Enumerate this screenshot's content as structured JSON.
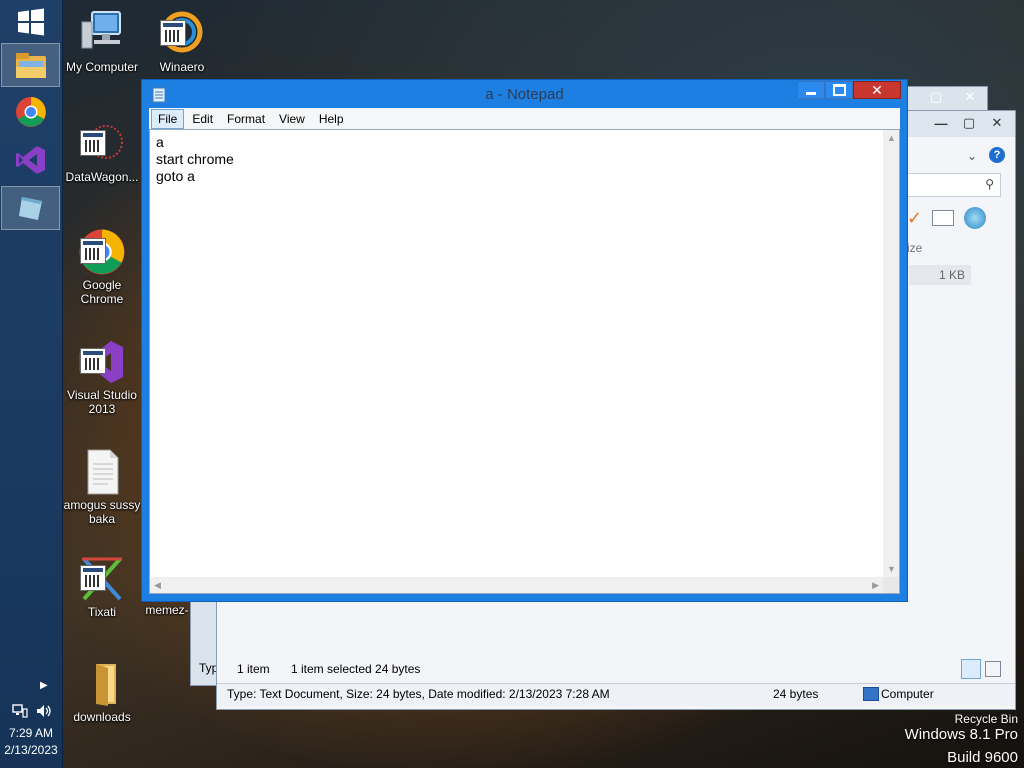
{
  "notepad": {
    "title": "a - Notepad",
    "menu": [
      "File",
      "Edit",
      "Format",
      "View",
      "Help"
    ],
    "lines": [
      "a",
      "start chrome",
      "goto a"
    ]
  },
  "desktop_icons": [
    {
      "label": "My Computer",
      "icon": "computer-icon"
    },
    {
      "label": "Winaero",
      "icon": "winaero-icon"
    },
    {
      "label": "DataWagon...",
      "icon": "datawagon-icon"
    },
    {
      "label": "Google Chrome",
      "icon": "chrome-icon"
    },
    {
      "label": "Visual Studio 2013",
      "icon": "visual-studio-icon"
    },
    {
      "label": "amogus sussy baka",
      "icon": "text-file-icon"
    },
    {
      "label": "Tixati",
      "icon": "tixati-icon"
    },
    {
      "label": "memez-",
      "icon": "folder-icon"
    },
    {
      "label": "downloads",
      "icon": "folder-icon"
    }
  ],
  "explorer": {
    "item_count": "1 item",
    "item_selected": "1 item selected  24 bytes",
    "details": "Type: Text Document, Size: 24 bytes, Date modified: 2/13/2023 7:28 AM",
    "size_cell": "24 bytes",
    "location": "Computer",
    "column_fragment": "ize",
    "file_size": "1 KB",
    "type_fragment": "Typ"
  },
  "tray": {
    "time": "7:29 AM",
    "date": "2/13/2023"
  },
  "os_watermark": {
    "recycle": "Recycle Bin",
    "edition": "Windows 8.1 Pro",
    "build": "Build 9600"
  },
  "colors": {
    "notepad_frame": "#1e7fe3",
    "close_button": "#c7372f",
    "taskbar": "#1a3a61"
  }
}
